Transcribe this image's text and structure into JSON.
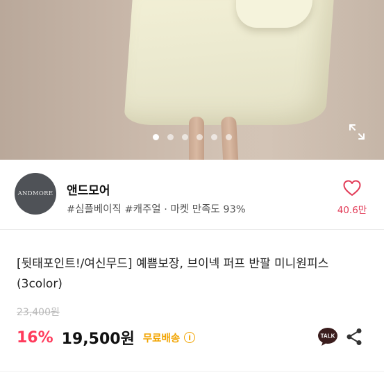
{
  "carousel": {
    "slide_count": 6,
    "active_index": 0
  },
  "icons": {
    "expand": "expand-icon",
    "heart": "heart-icon",
    "talk": "kakaotalk-icon",
    "share": "share-icon",
    "info": "info-icon"
  },
  "shop": {
    "logo_text": "ANDMORE",
    "name": "앤드모어",
    "tags": "#심플베이직 #캐주얼 · 마켓 만족도 93%",
    "likes": "40.6만"
  },
  "product": {
    "title": "[뒷태포인트!/여신무드] 예쁨보장, 브이넥 퍼프 반팔 미니원피스 (3color)",
    "original_price": "23,400원",
    "discount": "16%",
    "price": "19,500원",
    "shipping": "무료배송",
    "info_glyph": "i",
    "talk_label": "TALK"
  },
  "colors": {
    "accent_pink": "#ff3b5c",
    "heart": "#e23b57",
    "shipping": "#f2a400"
  }
}
